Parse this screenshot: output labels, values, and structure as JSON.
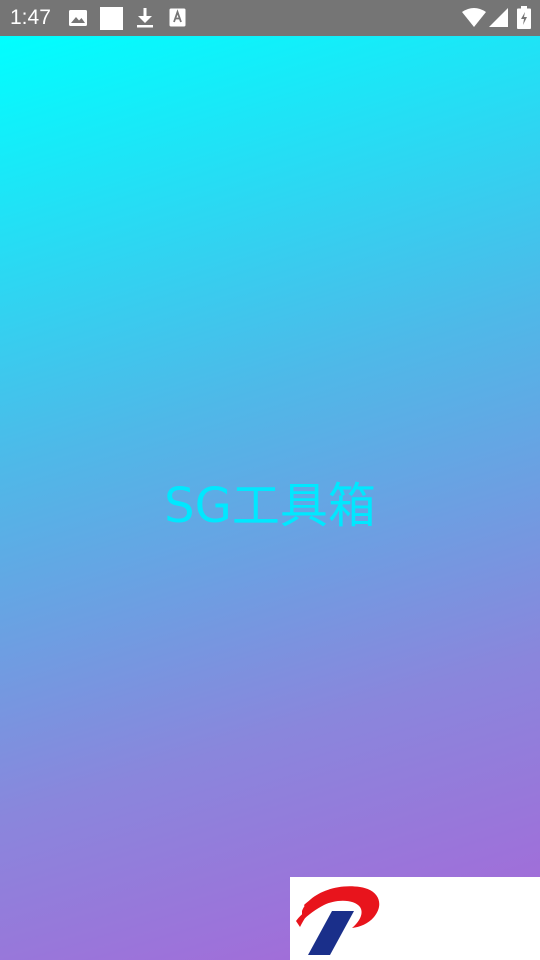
{
  "status_bar": {
    "time": "1:47",
    "icons": [
      "image-icon",
      "square-icon",
      "download-icon",
      "text-a-icon",
      "wifi-icon",
      "signal-icon",
      "battery-charging-icon"
    ]
  },
  "splash": {
    "app_name": "SG工具箱",
    "gradient_colors": [
      "#00ffff",
      "#4fb8e8",
      "#8a86dc",
      "#a866d8"
    ],
    "title_color": "#00e8ff"
  },
  "brand": {
    "logo": "brand-logo-icon",
    "logo_colors": [
      "#e8141c",
      "#1a2f8a"
    ]
  }
}
